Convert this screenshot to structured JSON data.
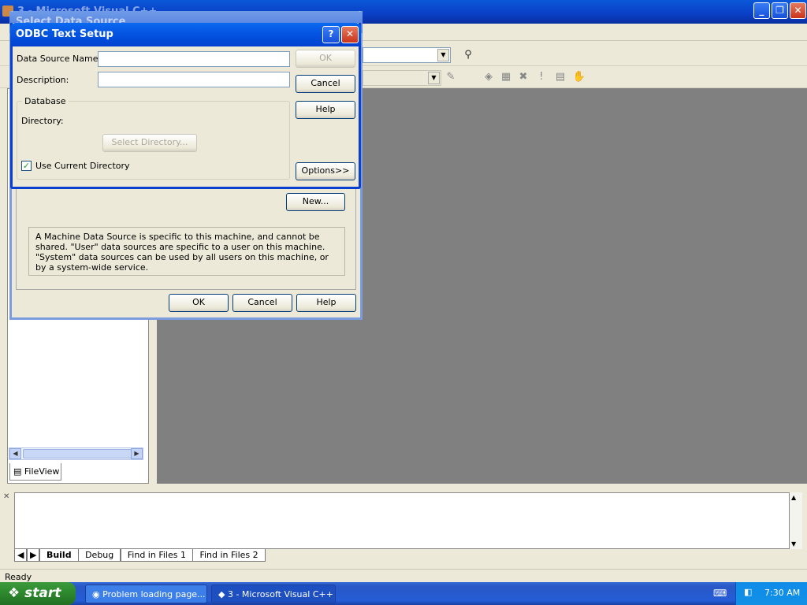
{
  "main_window": {
    "title": "3 - Microsoft Visual C++"
  },
  "select_data_source": {
    "title": "Select Data Source",
    "new_button": "New...",
    "info_text": "A Machine Data Source is specific to this machine, and cannot be shared. \"User\" data sources are specific to a user on this machine.  \"System\" data sources can be used by all users on this machine, or by a system-wide service.",
    "ok_button": "OK",
    "cancel_button": "Cancel",
    "help_button": "Help"
  },
  "odbc_setup": {
    "title": "ODBC Text Setup",
    "data_source_name_label": "Data Source Name:",
    "data_source_name_value": "",
    "description_label": "Description:",
    "description_value": "",
    "ok_button": "OK",
    "cancel_button": "Cancel",
    "help_button": "Help",
    "options_button": "Options>>",
    "database_group": "Database",
    "directory_label": "Directory:",
    "select_directory_button": "Select Directory...",
    "use_current_directory_label": "Use Current Directory",
    "use_current_directory_checked": true
  },
  "workspace": {
    "fileview_tab": "FileView"
  },
  "output": {
    "tabs": [
      "Build",
      "Debug",
      "Find in Files 1",
      "Find in Files 2"
    ]
  },
  "status": {
    "text": "Ready"
  },
  "taskbar": {
    "start_label": "start",
    "items": [
      {
        "label": "Problem loading page..."
      },
      {
        "label": "3 - Microsoft Visual C++"
      }
    ],
    "clock": "7:30 AM"
  }
}
